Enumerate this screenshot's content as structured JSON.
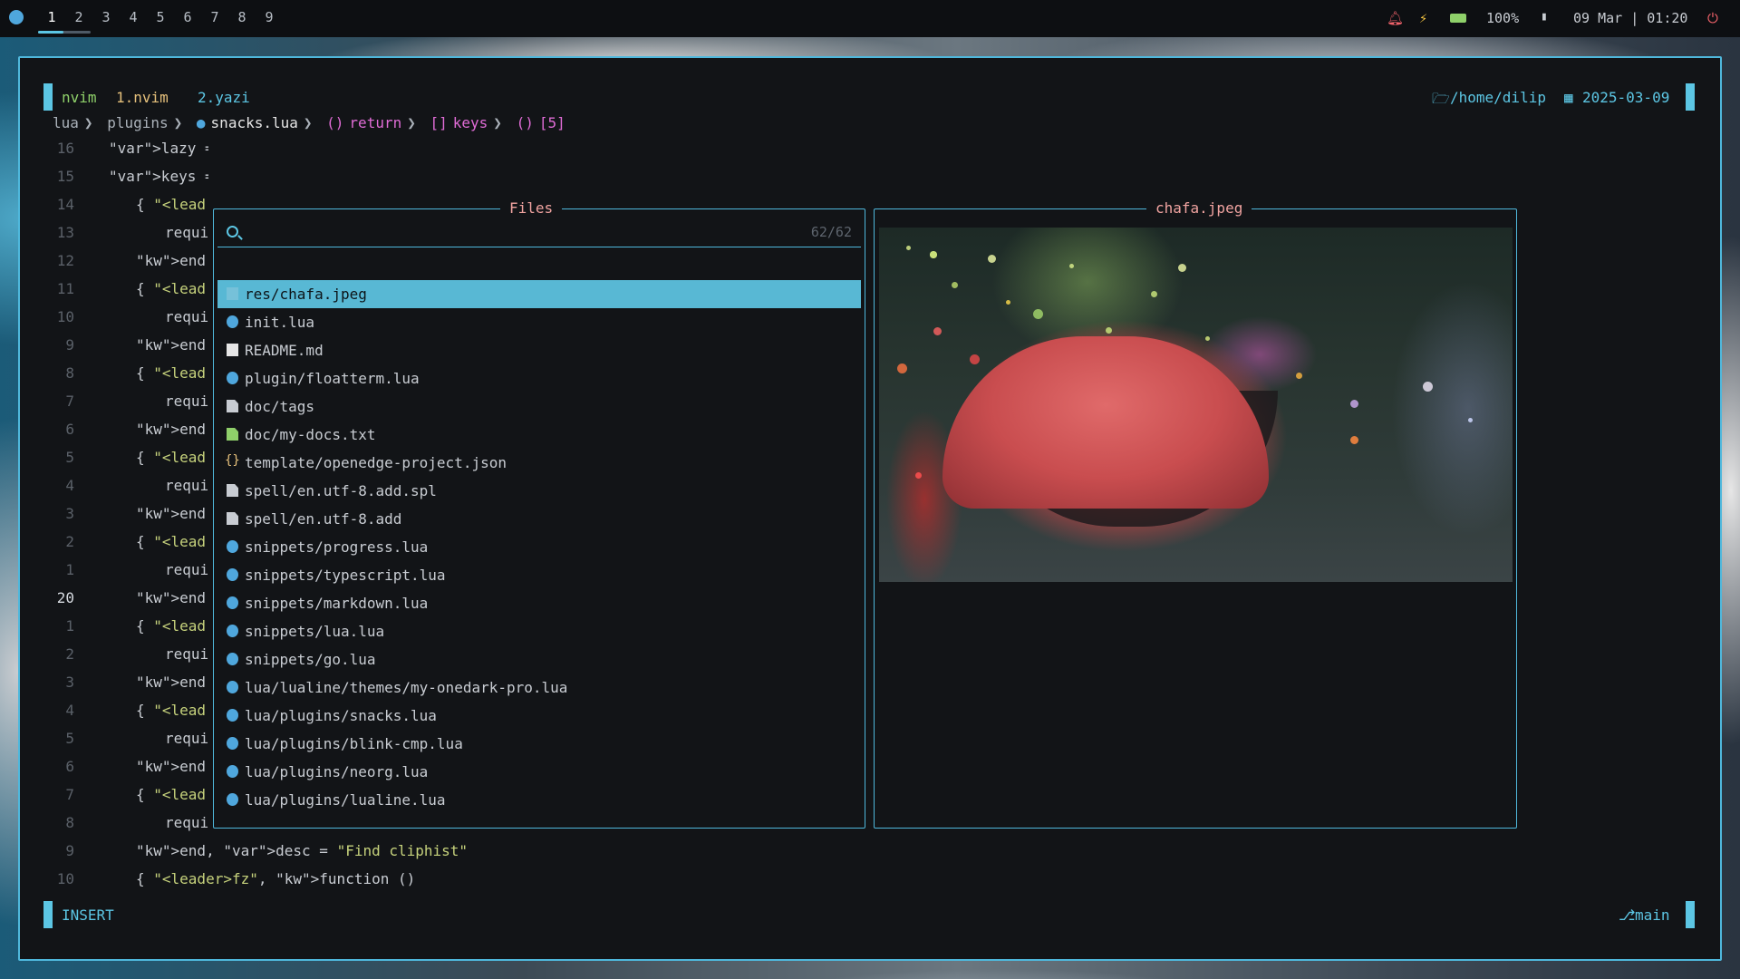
{
  "topbar": {
    "workspaces": [
      "1",
      "2",
      "3",
      "4",
      "5",
      "6",
      "7",
      "8",
      "9"
    ],
    "active_workspace": "1",
    "battery": "100%",
    "datetime": "09 Mar | 01:20"
  },
  "tabline": {
    "mode_label": "nvim",
    "tabs": [
      "1.nvim",
      "2.yazi"
    ],
    "cwd": "/home/dilip",
    "date": "2025-03-09"
  },
  "breadcrumb": {
    "parts": [
      "lua",
      "plugins",
      "snacks.lua",
      "return",
      "keys",
      "[5]"
    ]
  },
  "editor": {
    "lines": [
      {
        "n": "16",
        "text": "lazy = false,"
      },
      {
        "n": "15",
        "text": "keys = {"
      },
      {
        "n": "14",
        "text": "{ \"<lead"
      },
      {
        "n": "13",
        "text": "requi"
      },
      {
        "n": "12",
        "text": "end, des"
      },
      {
        "n": "11",
        "text": "{ \"<lead"
      },
      {
        "n": "10",
        "text": "requi"
      },
      {
        "n": "9",
        "text": "end, des"
      },
      {
        "n": "8",
        "text": "{ \"<lead"
      },
      {
        "n": "7",
        "text": "requi"
      },
      {
        "n": "6",
        "text": "end,  de"
      },
      {
        "n": "5",
        "text": "{ \"<lead"
      },
      {
        "n": "4",
        "text": "requi"
      },
      {
        "n": "3",
        "text": "end, des"
      },
      {
        "n": "2",
        "text": "{ \"<lead"
      },
      {
        "n": "1",
        "text": "requi"
      },
      {
        "n": "20",
        "text": "end, des"
      },
      {
        "n": "1",
        "text": "{ \"<lead"
      },
      {
        "n": "2",
        "text": "requi"
      },
      {
        "n": "3",
        "text": "end, des"
      },
      {
        "n": "4",
        "text": "{ \"<lead"
      },
      {
        "n": "5",
        "text": "requi"
      },
      {
        "n": "6",
        "text": "end, des"
      },
      {
        "n": "7",
        "text": "{ \"<lead"
      },
      {
        "n": "8",
        "text": "requi"
      },
      {
        "n": "9",
        "text": "end, desc = \"Find cliphist\"  },"
      },
      {
        "n": "10",
        "text": "{ \"<leader>fz\", function ()"
      }
    ]
  },
  "statusline": {
    "mode": "INSERT",
    "branch": "main"
  },
  "picker": {
    "title": "Files",
    "search_placeholder": "",
    "count": "62/62",
    "items": [
      {
        "name": "res/chafa.jpeg",
        "icon": "image-icon"
      },
      {
        "name": "init.lua",
        "icon": "lua-icon"
      },
      {
        "name": "README.md",
        "icon": "markdown-icon"
      },
      {
        "name": "plugin/floatterm.lua",
        "icon": "lua-icon"
      },
      {
        "name": "doc/tags",
        "icon": "file-icon"
      },
      {
        "name": "doc/my-docs.txt",
        "icon": "text-file-icon"
      },
      {
        "name": "template/openedge-project.json",
        "icon": "json-icon"
      },
      {
        "name": "spell/en.utf-8.add.spl",
        "icon": "file-icon"
      },
      {
        "name": "spell/en.utf-8.add",
        "icon": "file-icon"
      },
      {
        "name": "snippets/progress.lua",
        "icon": "lua-icon"
      },
      {
        "name": "snippets/typescript.lua",
        "icon": "lua-icon"
      },
      {
        "name": "snippets/markdown.lua",
        "icon": "lua-icon"
      },
      {
        "name": "snippets/lua.lua",
        "icon": "lua-icon"
      },
      {
        "name": "snippets/go.lua",
        "icon": "lua-icon"
      },
      {
        "name": "lua/lualine/themes/my-onedark-pro.lua",
        "icon": "lua-icon"
      },
      {
        "name": "lua/plugins/snacks.lua",
        "icon": "lua-icon"
      },
      {
        "name": "lua/plugins/blink-cmp.lua",
        "icon": "lua-icon"
      },
      {
        "name": "lua/plugins/neorg.lua",
        "icon": "lua-icon"
      },
      {
        "name": "lua/plugins/lualine.lua",
        "icon": "lua-icon"
      }
    ]
  },
  "preview": {
    "title": "chafa.jpeg"
  },
  "colors": {
    "accent": "#5cc6e4",
    "selection": "#58b8d4",
    "title": "#f0a3a0"
  }
}
